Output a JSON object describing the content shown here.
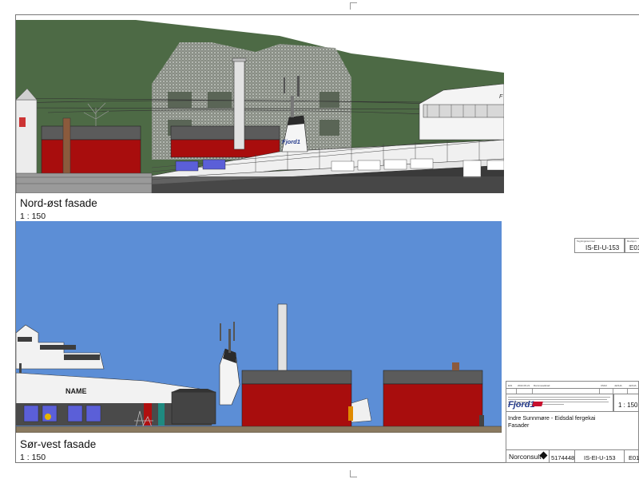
{
  "views": {
    "north_east": {
      "title": "Nord-øst fasade",
      "scale": "1 : 150"
    },
    "south_west": {
      "title": "Sør-vest fasade",
      "scale": "1 : 150",
      "ship_name": "NAME"
    }
  },
  "brand": {
    "ferry_logo": "Fjord1",
    "company": "Norconsult"
  },
  "title_block": {
    "drawing_no_label": "Tegningsnummer",
    "drawing_no": "IS-EI-U-153",
    "revision_label": "Revisjon",
    "revision": "E01",
    "revision_row": {
      "rev": "E01",
      "date": "2022-06-21",
      "text": "Rammesøknad",
      "drawn": "CMHI",
      "checked": "JaOHA",
      "approved": "JaOHA"
    },
    "scale": "1 : 150",
    "project": "Indre Sunnmøre - Eidsdal fergekai",
    "drawing_title": "Fasader",
    "project_number": "5174448",
    "drawing_number_bottom": "IS-EI-U-153",
    "revision_bottom": "E01"
  },
  "colors": {
    "sky": "#5c8ed6",
    "hillside": "#4d6a45",
    "building_red": "#a80d0d",
    "roof_grey": "#5b5b5b",
    "hull_dark": "#2f2f2f",
    "window_blue": "#5b5fd8"
  }
}
